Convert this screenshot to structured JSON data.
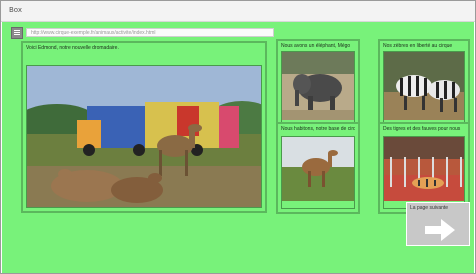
{
  "window": {
    "title": "Box"
  },
  "toolbar": {
    "url_text": "http://www.cirque-exemple.fr/animaux/activite/index.html"
  },
  "main_panel": {
    "caption": "Voici Edmond, notre nouvelle dromadaire."
  },
  "thumbnails": [
    {
      "caption": "Nous avons un éléphant, Mégo"
    },
    {
      "caption": "Nos zèbres en liberté au cirque"
    },
    {
      "caption": "Nous habitons, notre base de cirque"
    },
    {
      "caption": "Des tigres et des fauves pour nous"
    }
  ],
  "next_button": {
    "label": "La page suivante",
    "icon": "right-arrow-icon"
  },
  "colors": {
    "background": "#78f27a",
    "panel_border": "#5bb85d",
    "button": "#c8c8c8"
  }
}
